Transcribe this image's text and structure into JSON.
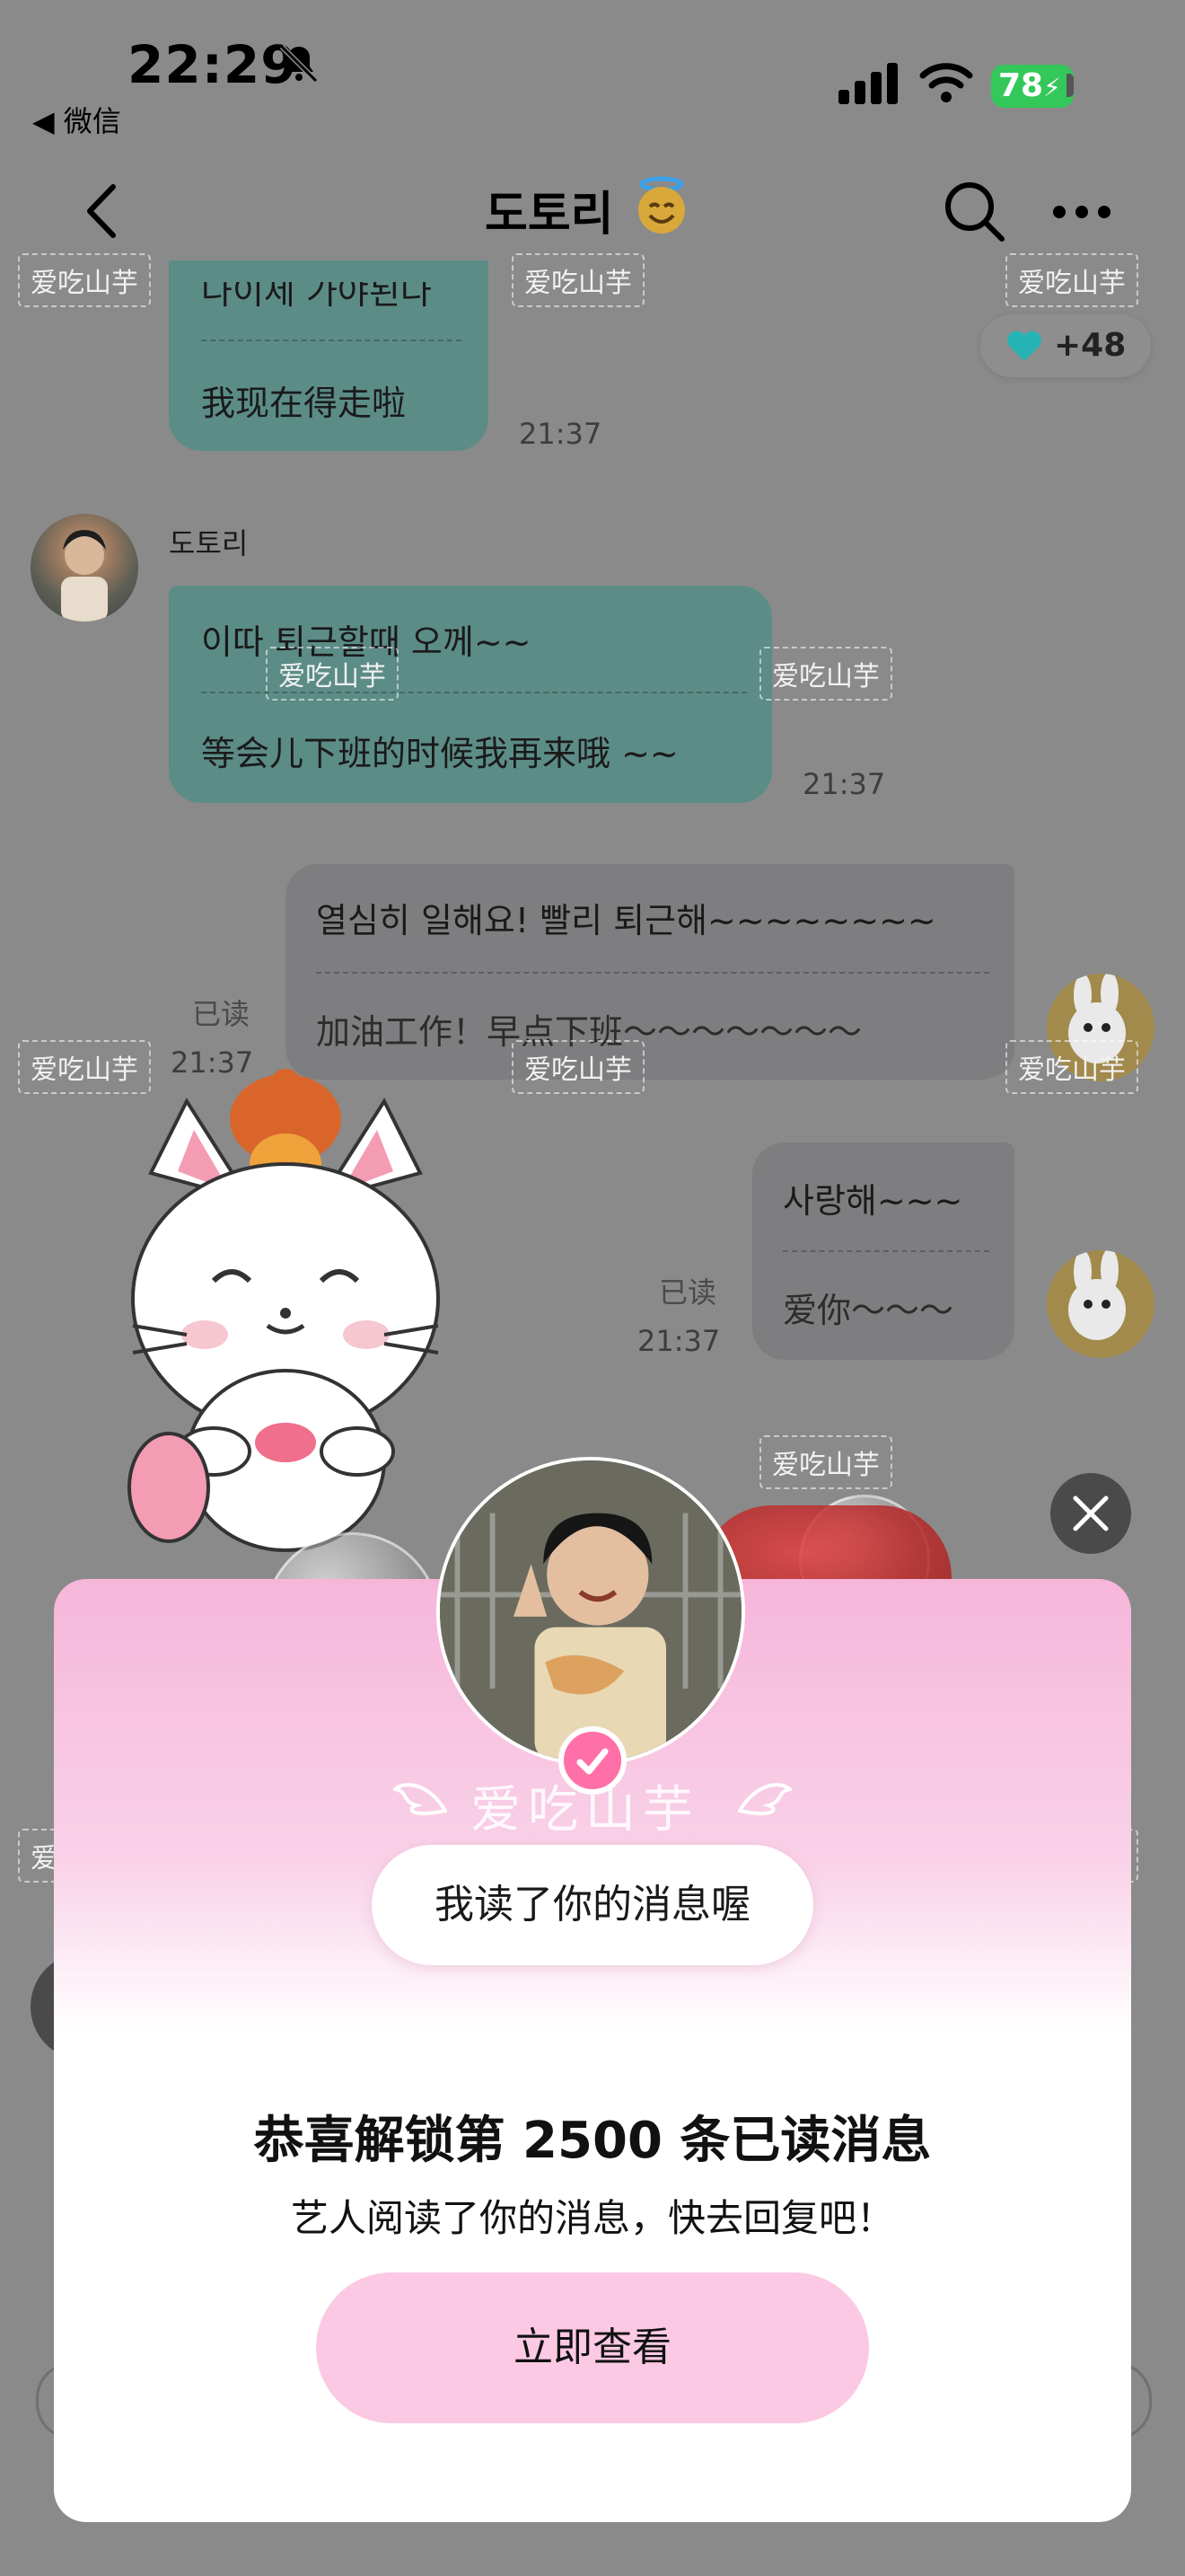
{
  "status_bar": {
    "time": "22:29",
    "back_app": "◀ 微信",
    "battery": "78"
  },
  "header": {
    "title": "도토리"
  },
  "watermark": "爱吃山芋",
  "heart_count": "+48",
  "messages": {
    "m1": {
      "line1": "나이제 가야된다",
      "line2": "我现在得走啦",
      "time": "21:37"
    },
    "sender": "도토리",
    "m2": {
      "line1": "이따 퇴근할때 오께~~",
      "line2": "等会儿下班的时候我再来哦 ~~",
      "time": "21:37"
    },
    "m3": {
      "line1": "열심히 일해요! 빨리 퇴근해~~~~~~~~",
      "line2": "加油工作！早点下班～～～～～～～",
      "read": "已读",
      "time": "21:37"
    },
    "m4": {
      "line1": "사랑해~~~",
      "line2": "爱你～～～",
      "read": "已读",
      "time": "21:37"
    }
  },
  "modal": {
    "decor_name": "爱吃山芋",
    "speech": "我读了你的消息喔",
    "title": "恭喜解锁第 2500 条已读消息",
    "subtitle": "艺人阅读了你的消息，快去回复吧！",
    "cta": "立即查看"
  },
  "colors": {
    "overlay": "#8a8a8a",
    "bubble_green": "#5c8c86",
    "cta_pink": "#fbc9e4",
    "check_pink": "#ff6fa8",
    "heart": "#26b3b3"
  }
}
